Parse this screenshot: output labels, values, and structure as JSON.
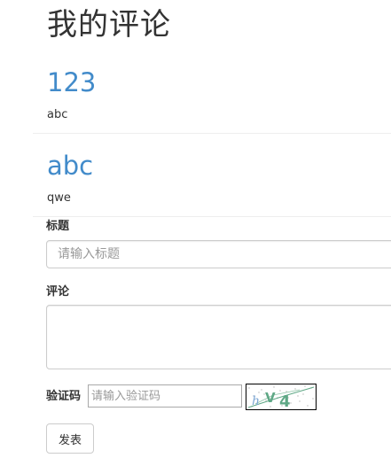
{
  "page": {
    "title": "我的评论"
  },
  "comments": [
    {
      "title": "123",
      "body": "abc"
    },
    {
      "title": "abc",
      "body": "qwe"
    }
  ],
  "form": {
    "title_label": "标题",
    "title_placeholder": "请输入标题",
    "comment_label": "评论",
    "captcha_label": "验证码",
    "captcha_placeholder": "请输入验证码",
    "captcha_text": "hV4",
    "submit_label": "发表"
  },
  "colors": {
    "link_blue": "#428bca",
    "text": "#333333",
    "border": "#cccccc",
    "captcha_green": "#5fa886"
  }
}
